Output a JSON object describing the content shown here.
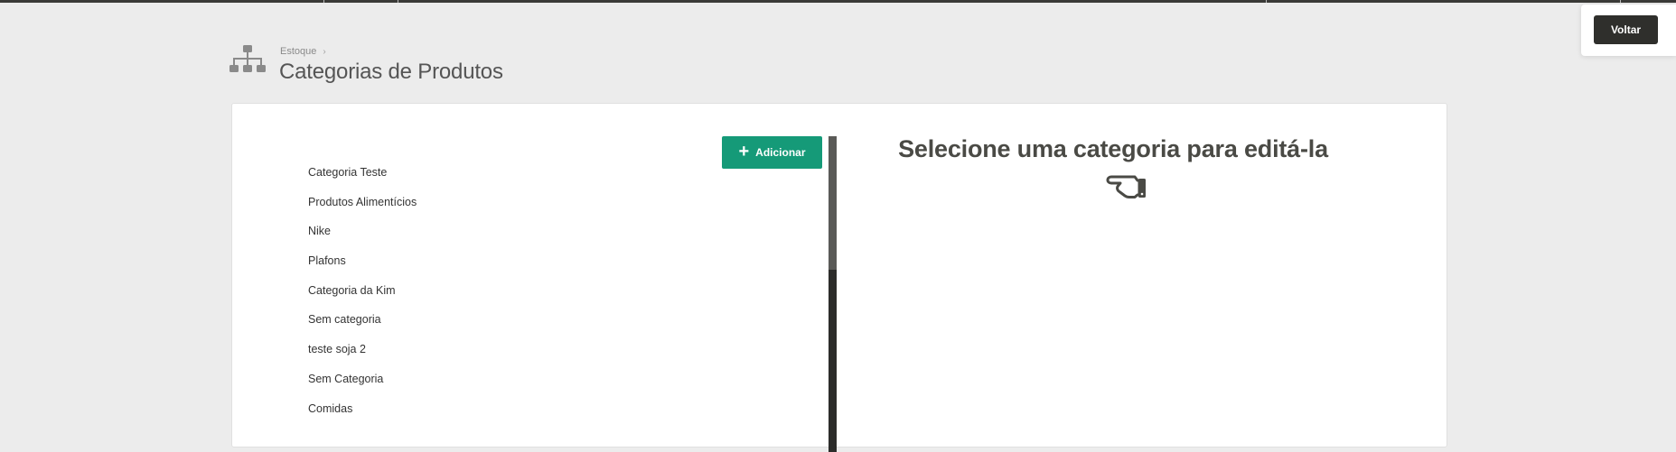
{
  "header": {
    "breadcrumb": "Estoque",
    "title": "Categorias de Produtos",
    "icon": "sitemap-icon"
  },
  "actions": {
    "back_label": "Voltar",
    "add_label": "Adicionar"
  },
  "categories": [
    "Categoria Teste",
    "Produtos Alimentícios",
    "Nike",
    "Plafons",
    "Categoria da Kim",
    "Sem categoria",
    "teste soja 2",
    "Sem Categoria",
    "Comidas"
  ],
  "editor": {
    "empty_message": "Selecione uma categoria para editá-la",
    "icon": "hand-pointing-left-icon"
  },
  "colors": {
    "accent": "#159a78",
    "dark": "#2f2f2c",
    "background": "#ececec"
  }
}
